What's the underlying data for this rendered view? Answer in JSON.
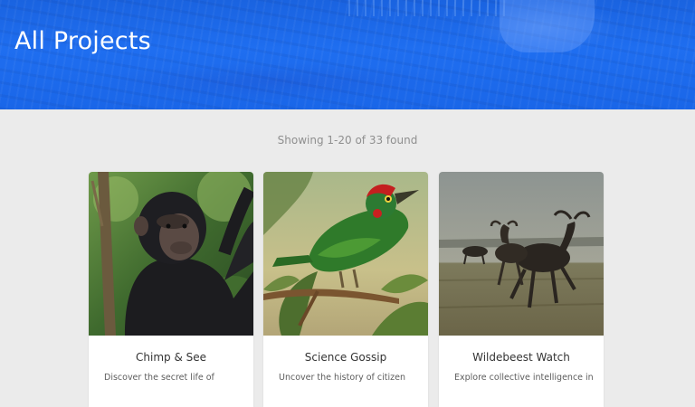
{
  "hero": {
    "title": "All Projects"
  },
  "results": {
    "count_text": "Showing 1-20 of 33 found"
  },
  "projects": [
    {
      "title": "Chimp & See",
      "description": "Discover the secret life of",
      "image": "chimpanzee-photo"
    },
    {
      "title": "Science Gossip",
      "description": "Uncover the history of citizen",
      "image": "bird-illustration"
    },
    {
      "title": "Wildebeest Watch",
      "description": "Explore collective intelligence in",
      "image": "wildebeest-photo"
    }
  ],
  "colors": {
    "hero": "#1f6ef0",
    "background": "#ebebeb",
    "card": "#ffffff"
  }
}
